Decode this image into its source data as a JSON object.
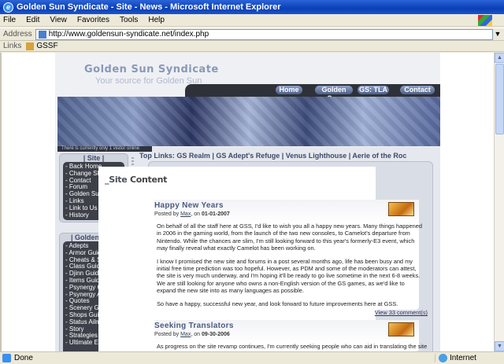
{
  "window": {
    "title": "Golden Sun Syndicate - Site - News - Microsoft Internet Explorer"
  },
  "menu": [
    "File",
    "Edit",
    "View",
    "Favorites",
    "Tools",
    "Help"
  ],
  "address": {
    "label": "Address",
    "url": "http://www.goldensun-syndicate.net/index.php"
  },
  "links_bar": {
    "label": "Links",
    "item": "GSSF"
  },
  "site": {
    "logo_title": "Golden Sun Syndicate",
    "logo_subtitle": "Your source for Golden Sun",
    "nav": [
      "Home",
      "Golden Sun",
      "GS: TLA",
      "Contact"
    ],
    "online_text": "There is currently only 1 visitor online",
    "top_links_label": "Top Links:",
    "top_links": "GS Realm | GS Adept's Refuge | Venus Lighthouse | Aerie of the Roc",
    "site_section": {
      "heading": "| Site |",
      "items": [
        "- Back Home",
        "- Change Skin",
        "- Contact",
        "- Forum",
        "- Golden Sun World",
        "- Links",
        "- Link to Us",
        "- History"
      ]
    },
    "gs_section": {
      "heading": "| Golden Sun|",
      "items": [
        "- Adepts",
        "- Armor Guide",
        "- Cheats & Secrets",
        "- Class Guide",
        "- Djinn Guide",
        "- Items Guide",
        "- Psynergy Guide",
        "- Psynergy Affected",
        "- Quotes",
        "- Scenery Guide",
        "- Shops Guide",
        "- Status Ailments",
        "- Story",
        "- Strategies",
        "- Ultimate Equip."
      ]
    },
    "content_title_prefix": "_Site",
    "content_title": "Content",
    "news": [
      {
        "title": "Happy New Years",
        "posted_by": "Posted by",
        "author": "Max",
        "on": ", on",
        "date": "01-01-2007",
        "paragraphs": [
          "On behalf of all the staff here at GSS, I'd like to wish you all a happy new years. Many things happened in 2006 in the gaming world, from the launch of the two new consoles, to Camelot's departure from Nintendo. While the chances are slim, I'm still looking forward to this year's formerly-E3 event, which may finally reveal what exactly Camelot has been working on.",
          "I know I promised the new site and forums in a post several months ago, life has been busy and my initial free time prediction was too hopeful. However, as PDM and some of the moderators can attest, the site is very much underway, and I'm hoping it'll be ready to go live sometime in the next 6-8 weeks. We are still looking for anyone who owns a non-English version of the GS games, as we'd like to expand the new site into as many languages as possible.",
          "So have a happy, successful new year, and look forward to future improvements here at GSS."
        ],
        "comments": "View 33 comment(s)"
      },
      {
        "title": "Seeking Translators",
        "posted_by": "Posted by",
        "author": "Max",
        "on": ", on",
        "date": "09-30-2006",
        "paragraphs": [
          "As progress on the site revamp continues, I'm currently seeking people who can aid in translating the site into"
        ]
      }
    ]
  },
  "status": {
    "text": "Done",
    "zone": "Internet"
  }
}
